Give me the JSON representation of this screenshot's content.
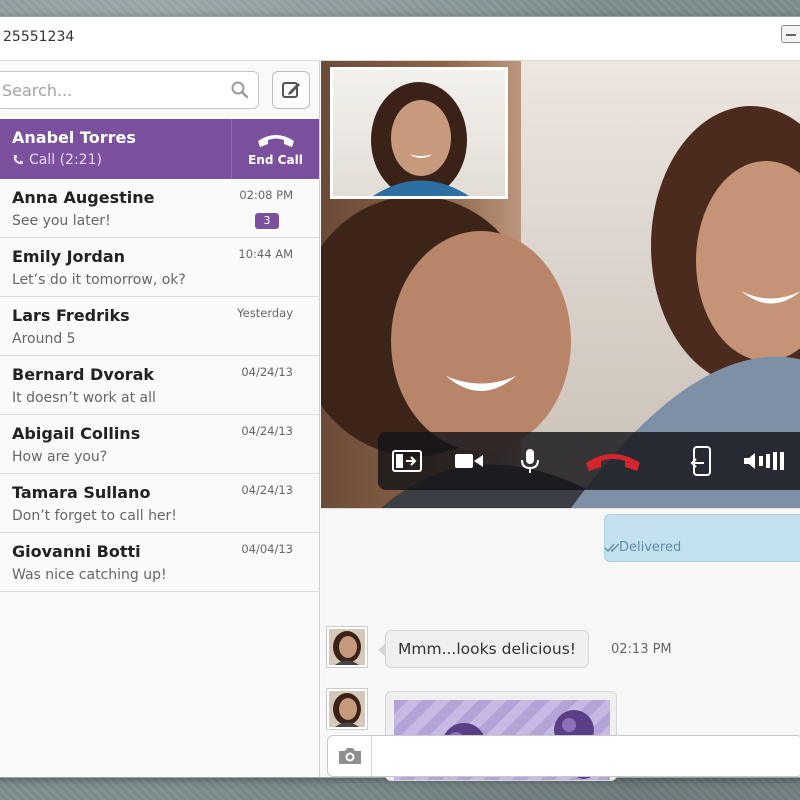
{
  "window": {
    "title": "25551234"
  },
  "search": {
    "placeholder": "Search..."
  },
  "active_call": {
    "name": "Anabel Torres",
    "status": "Call (2:21)",
    "end_call_label": "End Call",
    "accent": "#7b519d"
  },
  "contacts": [
    {
      "name": "Anna Augestine",
      "preview": "See you later!",
      "time": "02:08 PM",
      "badge": "3"
    },
    {
      "name": "Emily Jordan",
      "preview": "Let’s do it tomorrow, ok?",
      "time": "10:44 AM"
    },
    {
      "name": "Lars Fredriks",
      "preview": "Around 5",
      "time": "Yesterday"
    },
    {
      "name": "Bernard Dvorak",
      "preview": "It doesn’t work at all",
      "time": "04/24/13"
    },
    {
      "name": "Abigail Collins",
      "preview": "How are you?",
      "time": "04/24/13"
    },
    {
      "name": "Tamara Sullano",
      "preview": "Don’t forget to call her!",
      "time": "04/24/13"
    },
    {
      "name": "Giovanni Botti",
      "preview": "Was nice catching up!",
      "time": "04/04/13"
    }
  ],
  "call_controls": {
    "icons": [
      "minimize-video-icon",
      "video-camera-icon",
      "microphone-icon",
      "end-call-icon",
      "transfer-call-icon",
      "volume-icon"
    ],
    "end_call_color": "#d3262a"
  },
  "chat": {
    "delivered_status": "Delivered",
    "messages": [
      {
        "text": "Mmm...looks delicious!",
        "time": "02:13 PM"
      }
    ]
  },
  "composer": {
    "placeholder": ""
  }
}
